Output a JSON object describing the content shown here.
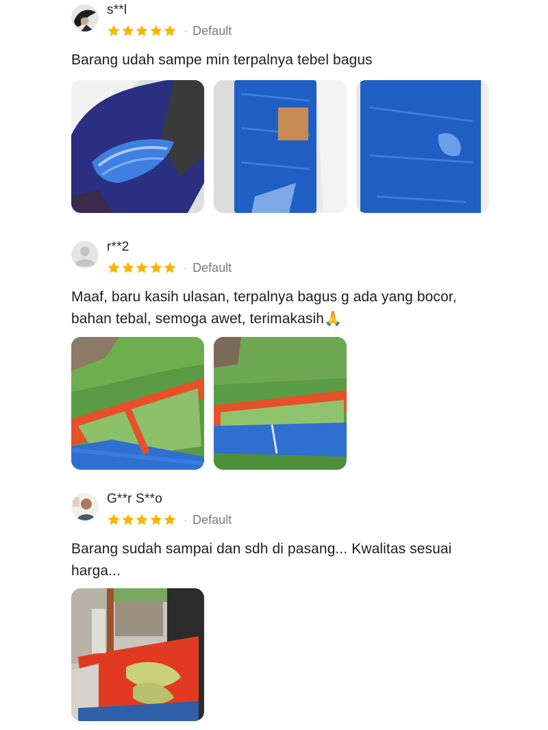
{
  "reviews": [
    {
      "username": "s**l",
      "rating": 5,
      "variant": "Default",
      "text": "Barang udah sampe min terpalnya tebel bagus",
      "photos": [
        "photo-folded-tarp-in-bag",
        "photo-rolled-tarp",
        "photo-tarp-closeup"
      ]
    },
    {
      "username": "r**2",
      "rating": 5,
      "variant": "Default",
      "text": "Maaf, baru kasih ulasan, terpalnya bagus g ada yang bocor, bahan tebal, semoga awet, terimakasih🙏",
      "photos": [
        "photo-pond-on-grass-1",
        "photo-pond-on-grass-2"
      ]
    },
    {
      "username": "G**r S**o",
      "rating": 5,
      "variant": "Default",
      "text": "Barang sudah sampai dan sdh di pasang... Kwalitas sesuai harga...",
      "photos": [
        "photo-pond-with-frame"
      ]
    }
  ],
  "separator": "·",
  "colors": {
    "star": "#f7b500",
    "tarp_blue": "#1f5fc4",
    "tarp_orange": "#e8502a",
    "grass": "#4f8f3a"
  }
}
